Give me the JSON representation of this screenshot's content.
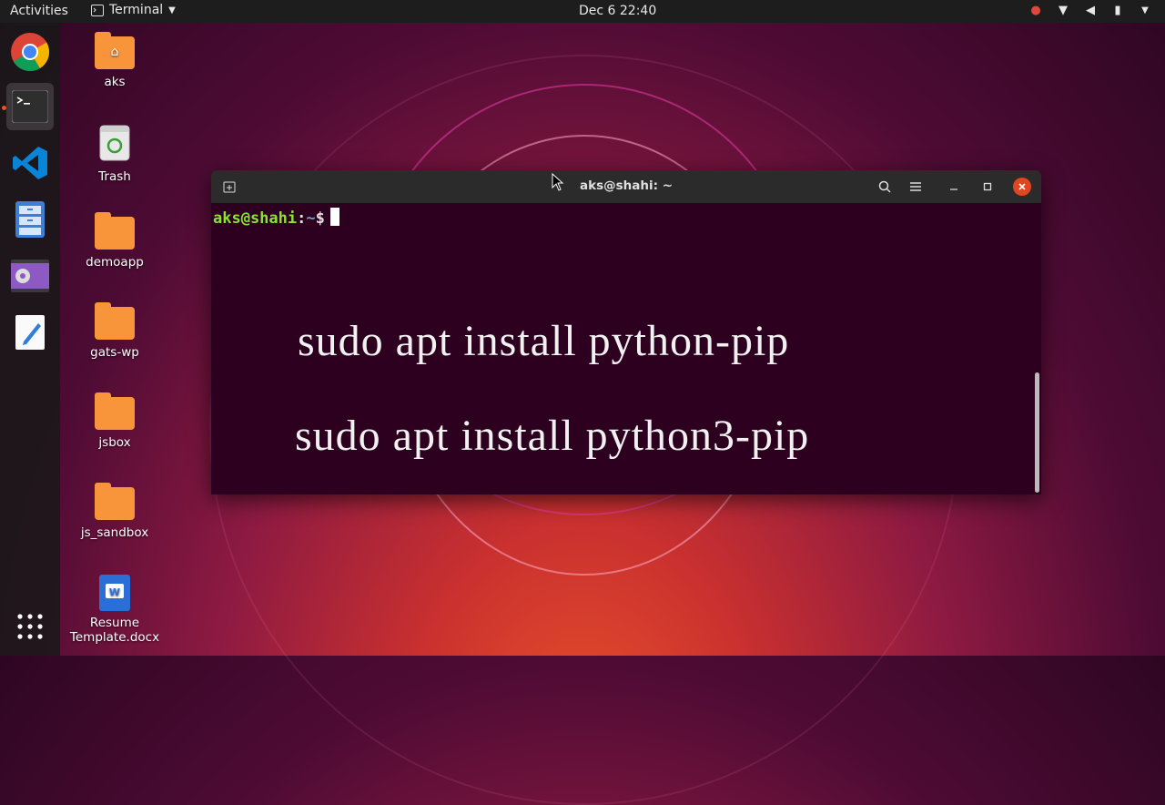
{
  "topbar": {
    "activities": "Activities",
    "app_name": "Terminal",
    "clock": "Dec 6  22:40"
  },
  "desktop": {
    "icons": [
      {
        "label": "aks"
      },
      {
        "label": "Trash"
      },
      {
        "label": "demoapp"
      },
      {
        "label": "gats-wp"
      },
      {
        "label": "jsbox"
      },
      {
        "label": "js_sandbox"
      },
      {
        "label": "Resume Template.docx"
      }
    ]
  },
  "terminal": {
    "title": "aks@shahi: ~",
    "prompt_user": "aks@shahi",
    "prompt_sep": ":",
    "prompt_path": "~",
    "prompt_sign": "$",
    "overlay_line1": "sudo apt install python-pip",
    "overlay_line2": "sudo apt install python3-pip"
  },
  "colors": {
    "terminal_bg": "#2c001e",
    "prompt_user": "#8ae234",
    "prompt_path": "#729fcf",
    "accent": "#e95420"
  }
}
